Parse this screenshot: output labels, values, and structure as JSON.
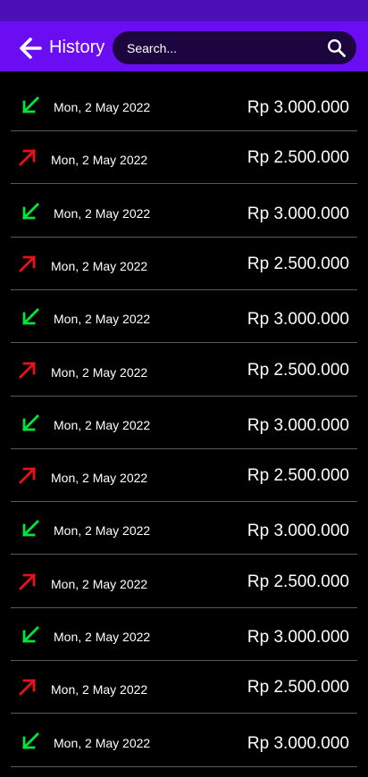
{
  "header": {
    "title": "History",
    "colors": {
      "status_bar": "#4b10b8",
      "app_bar": "#6a0df2",
      "search_bg": "#1d0640"
    }
  },
  "search": {
    "placeholder": "Search...",
    "value": ""
  },
  "icons": {
    "back": "arrow-left-icon",
    "search": "search-icon",
    "incoming": "arrow-down-left-icon",
    "outgoing": "arrow-up-right-icon"
  },
  "colors": {
    "incoming": "#00e63a",
    "outgoing": "#e8101a",
    "divider": "#5a5a5a",
    "background": "#000000"
  },
  "history": [
    {
      "type": "incoming",
      "date": "Mon, 2 May 2022",
      "amount": "Rp 3.000.000"
    },
    {
      "type": "outgoing",
      "date": "Mon, 2 May 2022",
      "amount": "Rp 2.500.000"
    },
    {
      "type": "incoming",
      "date": "Mon, 2 May 2022",
      "amount": "Rp 3.000.000"
    },
    {
      "type": "outgoing",
      "date": "Mon, 2 May 2022",
      "amount": "Rp 2.500.000"
    },
    {
      "type": "incoming",
      "date": "Mon, 2 May 2022",
      "amount": "Rp 3.000.000"
    },
    {
      "type": "outgoing",
      "date": "Mon, 2 May 2022",
      "amount": "Rp 2.500.000"
    },
    {
      "type": "incoming",
      "date": "Mon, 2 May 2022",
      "amount": "Rp 3.000.000"
    },
    {
      "type": "outgoing",
      "date": "Mon, 2 May 2022",
      "amount": "Rp 2.500.000"
    },
    {
      "type": "incoming",
      "date": "Mon, 2 May 2022",
      "amount": "Rp 3.000.000"
    },
    {
      "type": "outgoing",
      "date": "Mon, 2 May 2022",
      "amount": "Rp 2.500.000"
    },
    {
      "type": "incoming",
      "date": "Mon, 2 May 2022",
      "amount": "Rp 3.000.000"
    },
    {
      "type": "outgoing",
      "date": "Mon, 2 May 2022",
      "amount": "Rp 2.500.000"
    },
    {
      "type": "incoming",
      "date": "Mon, 2 May 2022",
      "amount": "Rp 3.000.000"
    }
  ]
}
